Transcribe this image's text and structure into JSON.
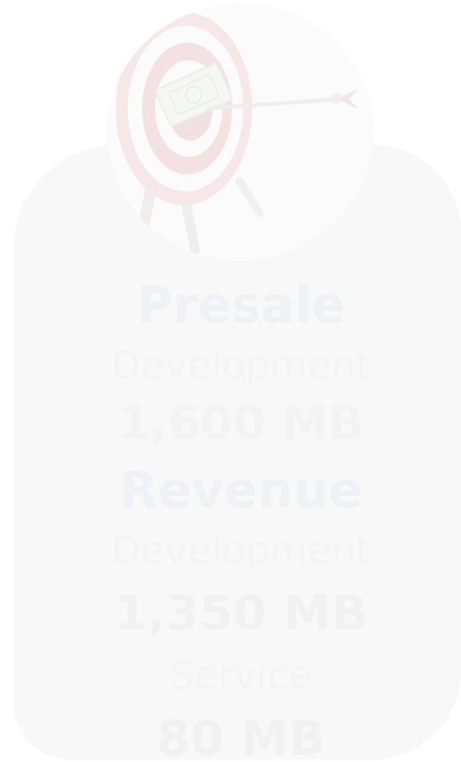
{
  "presale": {
    "title": "Presale",
    "development_label": "Development",
    "development_value": "1,600 MB"
  },
  "revenue": {
    "title": "Revenue",
    "development_label": "Development",
    "development_value": "1,350 MB",
    "service_label": "Service",
    "service_value": "80 MB"
  },
  "colors": {
    "title": "#eff1f7",
    "card": "#f8f8f8",
    "target_red": "#f3e4e4"
  },
  "icons": {
    "badge": "target-with-arrow-and-money-icon"
  }
}
